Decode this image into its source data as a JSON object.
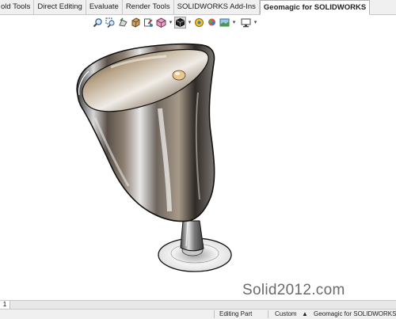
{
  "ribbon": {
    "tabs": [
      {
        "label": "old Tools"
      },
      {
        "label": "Direct Editing"
      },
      {
        "label": "Evaluate"
      },
      {
        "label": "Render Tools"
      },
      {
        "label": "SOLIDWORKS Add-Ins"
      },
      {
        "label": "Geomagic for SOLIDWORKS"
      }
    ],
    "active_tab": "Geomagic for SOLIDWORKS"
  },
  "view_toolbar": {
    "icons": [
      "zoom-to-fit-icon",
      "zoom-to-area-icon",
      "previous-view-icon",
      "section-view-icon",
      "dynamic-annotation-view-icon",
      "view-orientation-icon",
      "display-style-icon",
      "hide-show-items-icon",
      "edit-appearance-icon",
      "apply-scene-icon",
      "view-settings-icon"
    ]
  },
  "graphics": {
    "watermark": "Solid2012.com"
  },
  "bottom_tabs": {
    "sheet_label": "1"
  },
  "status_bar": {
    "editing": "Editing Part",
    "units": "Custom",
    "units_arrow": "▲",
    "addin": "Geomagic for SOLIDWORKS - [E"
  },
  "colors": {
    "accent": "#1e6fc8",
    "ribbon_bg": "#f0f0f0"
  }
}
